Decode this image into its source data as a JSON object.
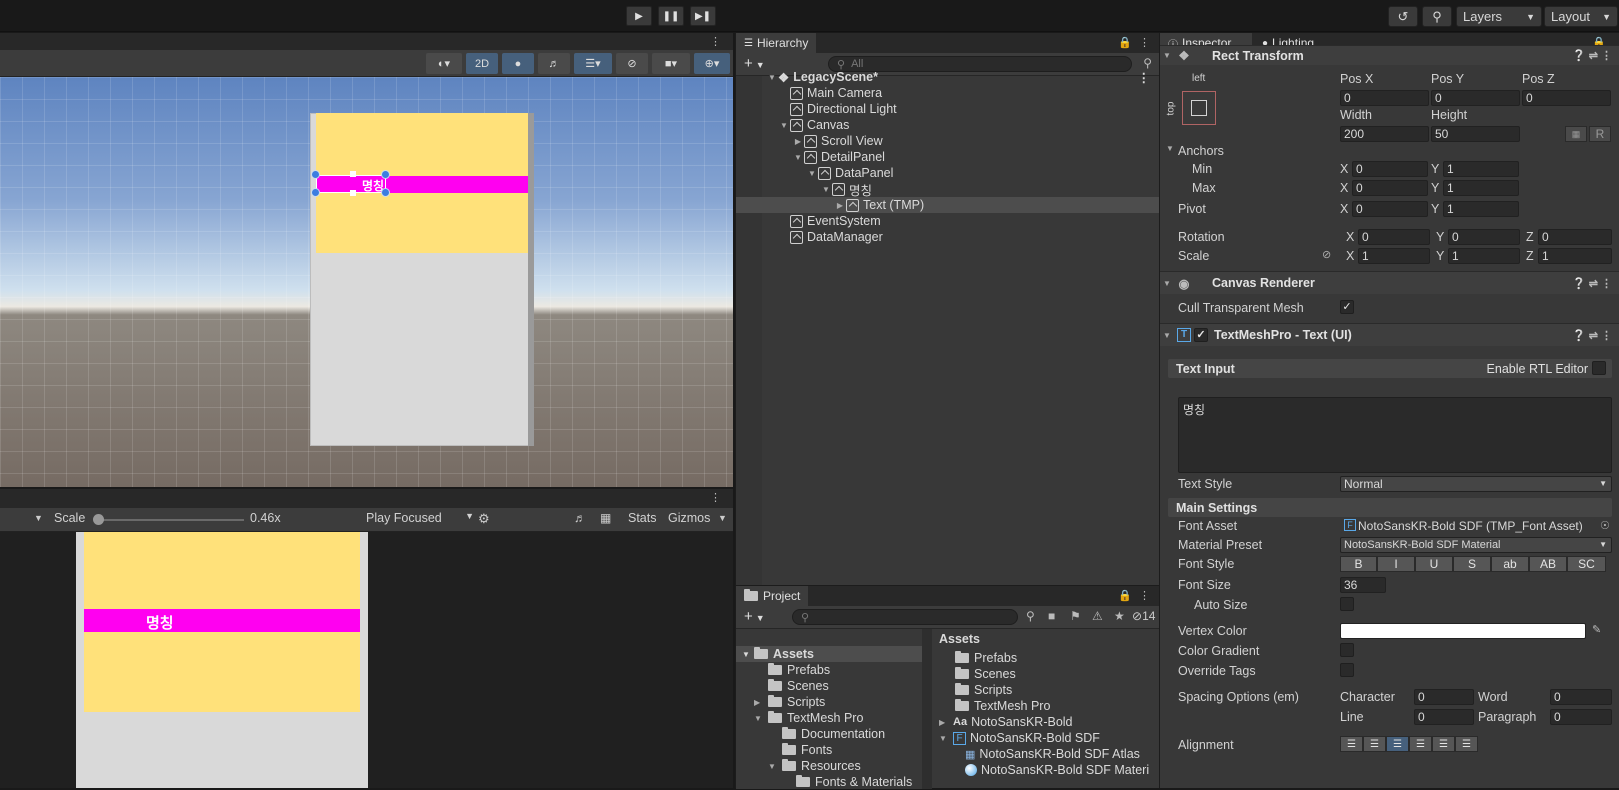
{
  "toolbar": {
    "play_icon": "play-icon",
    "pause_icon": "pause-icon",
    "step_icon": "step-icon",
    "layers_label": "Layers",
    "layout_label": "Layout"
  },
  "scene": {
    "mode_2d": "2D",
    "selection_text": "명칭"
  },
  "game": {
    "scale_label": "Scale",
    "scale_value": "0.46x",
    "play_mode": "Play Focused",
    "stats_label": "Stats",
    "gizmos_label": "Gizmos",
    "banner_text": "명칭"
  },
  "hierarchy": {
    "tab_label": "Hierarchy",
    "search_placeholder": "All",
    "rows": [
      {
        "label": "LegacyScene*"
      },
      {
        "label": "Main Camera"
      },
      {
        "label": "Directional Light"
      },
      {
        "label": "Canvas"
      },
      {
        "label": "Scroll View"
      },
      {
        "label": "DetailPanel"
      },
      {
        "label": "DataPanel"
      },
      {
        "label": "명칭"
      },
      {
        "label": "Text (TMP)"
      },
      {
        "label": "EventSystem"
      },
      {
        "label": "DataManager"
      }
    ]
  },
  "project": {
    "tab_label": "Project",
    "hidden_count": "14",
    "tree": [
      {
        "label": "Assets"
      },
      {
        "label": "Prefabs"
      },
      {
        "label": "Scenes"
      },
      {
        "label": "Scripts"
      },
      {
        "label": "TextMesh Pro"
      },
      {
        "label": "Documentation"
      },
      {
        "label": "Fonts"
      },
      {
        "label": "Resources"
      },
      {
        "label": "Fonts & Materials"
      }
    ],
    "breadcrumb": "Assets",
    "assets": [
      {
        "label": "Prefabs"
      },
      {
        "label": "Scenes"
      },
      {
        "label": "Scripts"
      },
      {
        "label": "TextMesh Pro"
      },
      {
        "label": "NotoSansKR-Bold"
      },
      {
        "label": "NotoSansKR-Bold SDF"
      },
      {
        "label": "NotoSansKR-Bold SDF Atlas"
      },
      {
        "label": "NotoSansKR-Bold SDF Materi"
      }
    ]
  },
  "inspector": {
    "tab_inspector": "Inspector",
    "tab_lighting": "Lighting",
    "rect_transform": {
      "title": "Rect Transform",
      "anchor_preset_h": "left",
      "anchor_preset_v": "top",
      "pos_x_label": "Pos X",
      "pos_x": "0",
      "pos_y_label": "Pos Y",
      "pos_y": "0",
      "pos_z_label": "Pos Z",
      "pos_z": "0",
      "width_label": "Width",
      "width": "200",
      "height_label": "Height",
      "height": "50",
      "r_button": "R",
      "anchors_label": "Anchors",
      "min_label": "Min",
      "min_x": "0",
      "min_y": "1",
      "max_label": "Max",
      "max_x": "0",
      "max_y": "1",
      "pivot_label": "Pivot",
      "pivot_x": "0",
      "pivot_y": "1",
      "rotation_label": "Rotation",
      "rot_x": "0",
      "rot_y": "0",
      "rot_z": "0",
      "scale_label": "Scale",
      "scale_x": "1",
      "scale_y": "1",
      "scale_z": "1",
      "x": "X",
      "y": "Y",
      "z": "Z"
    },
    "canvas_renderer": {
      "title": "Canvas Renderer",
      "cull_label": "Cull Transparent Mesh",
      "cull_checked": "✓"
    },
    "tmp": {
      "title": "TextMeshPro - Text (UI)",
      "enabled": "✓",
      "text_input_label": "Text Input",
      "rtl_label": "Enable RTL Editor",
      "text_value": "명칭",
      "text_style_label": "Text Style",
      "text_style_value": "Normal",
      "main_settings": "Main Settings",
      "font_asset_label": "Font Asset",
      "font_asset_value": "NotoSansKR-Bold SDF (TMP_Font Asset)",
      "material_preset_label": "Material Preset",
      "material_preset_value": "NotoSansKR-Bold SDF Material",
      "font_style_label": "Font Style",
      "font_style_buttons": [
        "B",
        "I",
        "U",
        "S",
        "ab",
        "AB",
        "SC"
      ],
      "font_size_label": "Font Size",
      "font_size_value": "36",
      "auto_size_label": "Auto Size",
      "vertex_color_label": "Vertex Color",
      "vertex_color": "#ffffff",
      "color_gradient_label": "Color Gradient",
      "override_tags_label": "Override Tags",
      "spacing_label": "Spacing Options (em)",
      "character_label": "Character",
      "character_value": "0",
      "word_label": "Word",
      "word_value": "0",
      "line_label": "Line",
      "line_value": "0",
      "paragraph_label": "Paragraph",
      "paragraph_value": "0",
      "alignment_label": "Alignment"
    }
  },
  "colors": {
    "ui_panel_yellow": "#ffe17a",
    "magenta": "#ff00f0",
    "selection": "#4d4d4d"
  }
}
